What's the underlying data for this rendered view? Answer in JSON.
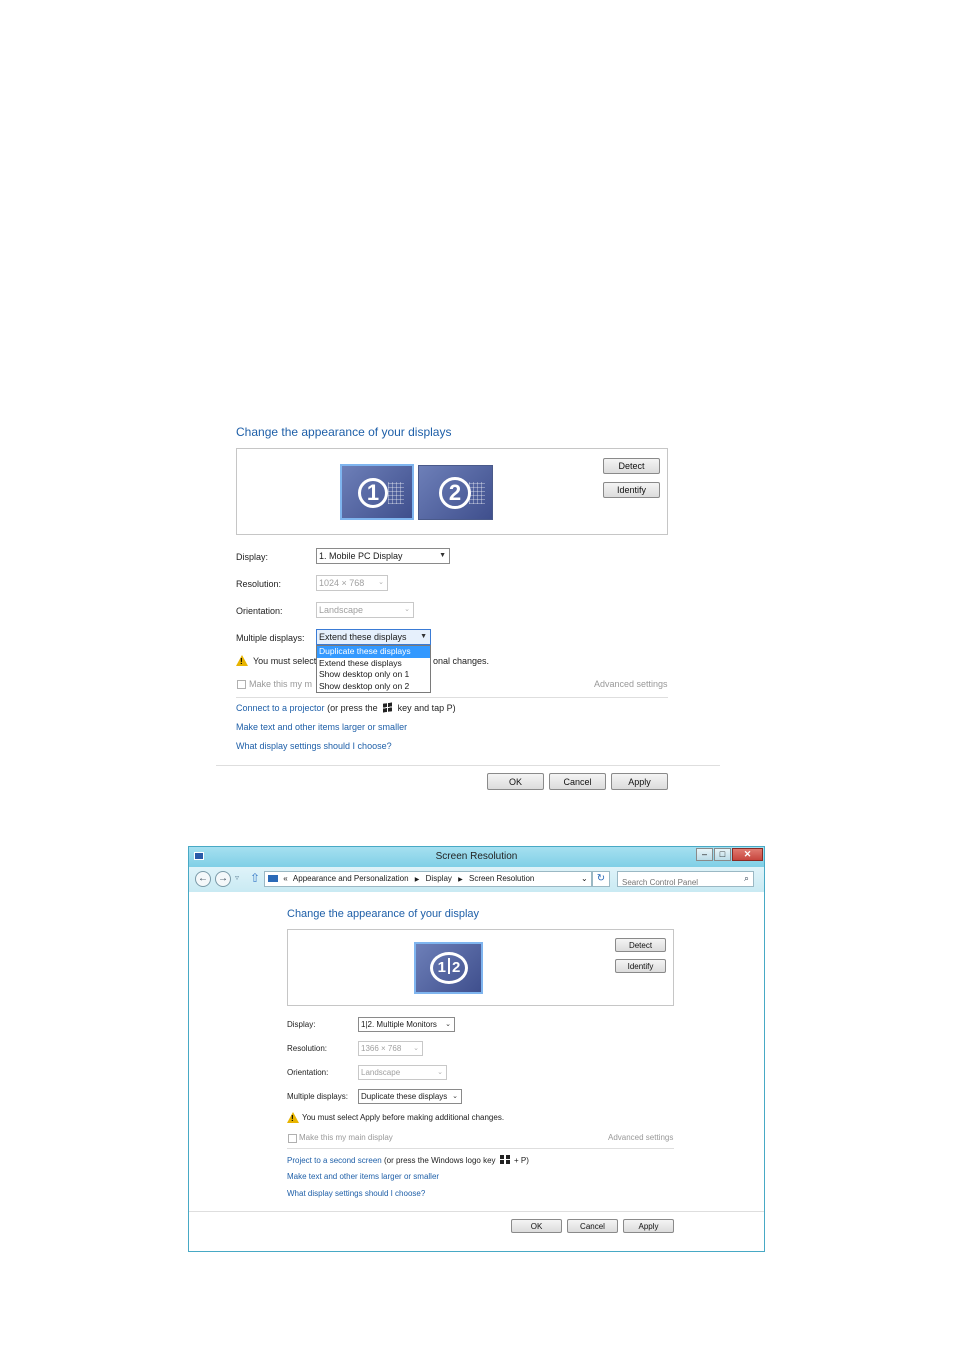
{
  "top": {
    "heading": "Change the appearance of your displays",
    "monitor1": "1",
    "monitor2": "2",
    "detect": "Detect",
    "identify": "Identify",
    "display_label": "Display:",
    "display_value": "1. Mobile PC Display",
    "resolution_label": "Resolution:",
    "resolution_value": "1024 × 768",
    "orientation_label": "Orientation:",
    "orientation_value": "Landscape",
    "multi_label": "Multiple displays:",
    "multi_value": "Extend these displays",
    "dropdown_options": [
      "Duplicate these displays",
      "Extend these displays",
      "Show desktop only on 1",
      "Show desktop only on 2"
    ],
    "warning_prefix": "You must select",
    "warning_suffix": "onal changes.",
    "main_display_prefix": "Make this my m",
    "advanced": "Advanced settings",
    "link1": "Connect to a projector",
    "link1_rest_a": "(or press the",
    "link1_rest_b": "key and tap P)",
    "link2": "Make text and other items larger or smaller",
    "link3": "What display settings should I choose?",
    "ok": "OK",
    "cancel": "Cancel",
    "apply": "Apply"
  },
  "window": {
    "title": "Screen Resolution",
    "breadcrumb_prefix": "«",
    "crumb1": "Appearance and Personalization",
    "crumb2": "Display",
    "crumb3": "Screen Resolution",
    "search_placeholder": "Search Control Panel",
    "heading": "Change the appearance of your display",
    "monitor_label_1": "1",
    "monitor_label_2": "2",
    "detect": "Detect",
    "identify": "Identify",
    "display_label": "Display:",
    "display_value": "1|2. Multiple Monitors",
    "resolution_label": "Resolution:",
    "resolution_value": "1366 × 768",
    "orientation_label": "Orientation:",
    "orientation_value": "Landscape",
    "multi_label": "Multiple displays:",
    "multi_value": "Duplicate these displays",
    "warning": "You must select Apply before making additional changes.",
    "main_display": "Make this my main display",
    "advanced": "Advanced settings",
    "link1": "Project to a second screen",
    "link1_rest_a": "(or press the Windows logo key",
    "link1_rest_b": "+ P)",
    "link2": "Make text and other items larger or smaller",
    "link3": "What display settings should I choose?",
    "ok": "OK",
    "cancel": "Cancel",
    "apply": "Apply"
  },
  "colors": {
    "accent": "#1e5fa8",
    "highlight": "#3399ff",
    "titlebar": "#7fcfe6",
    "close": "#c7463e"
  }
}
